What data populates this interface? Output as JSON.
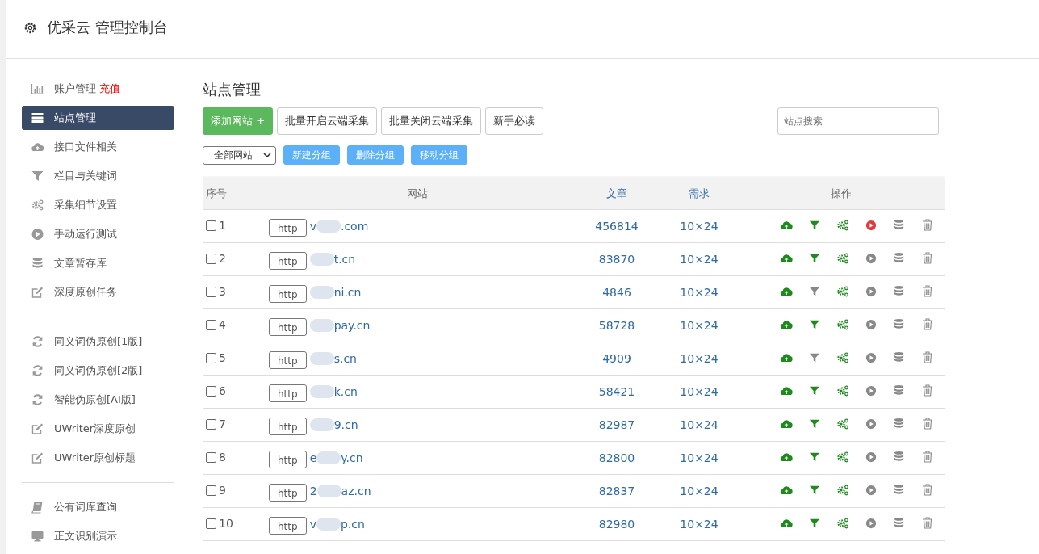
{
  "header": {
    "title": "优采云 管理控制台"
  },
  "sidebar": {
    "groups": [
      [
        {
          "kind": "chart",
          "label": "账户管理",
          "badge": "充值",
          "selected": false
        },
        {
          "kind": "list",
          "label": "站点管理",
          "selected": true
        },
        {
          "kind": "cloud",
          "label": "接口文件相关",
          "selected": false
        },
        {
          "kind": "filter",
          "label": "栏目与关键词",
          "selected": false
        },
        {
          "kind": "gears",
          "label": "采集细节设置",
          "selected": false
        },
        {
          "kind": "play",
          "label": "手动运行测试",
          "selected": false
        },
        {
          "kind": "database",
          "label": "文章暂存库",
          "selected": false
        },
        {
          "kind": "edit",
          "label": "深度原创任务",
          "selected": false
        }
      ],
      [
        {
          "kind": "refresh",
          "label": "同义词伪原创[1版]",
          "selected": false
        },
        {
          "kind": "refresh",
          "label": "同义词伪原创[2版]",
          "selected": false
        },
        {
          "kind": "refresh",
          "label": "智能伪原创[AI版]",
          "selected": false
        },
        {
          "kind": "edit",
          "label": "UWriter深度原创",
          "selected": false
        },
        {
          "kind": "edit",
          "label": "UWriter原创标题",
          "selected": false
        }
      ],
      [
        {
          "kind": "book",
          "label": "公有词库查询",
          "selected": false
        },
        {
          "kind": "monitor",
          "label": "正文识别演示",
          "selected": false
        }
      ]
    ]
  },
  "main": {
    "title": "站点管理",
    "buttons": [
      {
        "kind": "primary",
        "label": "添加网站 +"
      },
      {
        "kind": "default",
        "label": "批量开启云端采集"
      },
      {
        "kind": "default",
        "label": "批量关闭云端采集"
      },
      {
        "kind": "default",
        "label": "新手必读"
      }
    ],
    "search": {
      "placeholder": "站点搜索"
    },
    "group_select": {
      "value": "全部网站"
    },
    "group_buttons": [
      "新建分组",
      "删除分组",
      "移动分组"
    ],
    "table": {
      "columns": [
        "序号",
        "网站",
        "文章",
        "需求",
        "操作"
      ],
      "rows": [
        {
          "checked": false,
          "index": "1",
          "protocol": "http",
          "domain_start": "v",
          "domain_end": ".com",
          "articles": "456814",
          "demand": "10×24",
          "filter_on": true,
          "running": true
        },
        {
          "checked": false,
          "index": "2",
          "protocol": "http",
          "domain_start": "",
          "domain_end": "t.cn",
          "articles": "83870",
          "demand": "10×24",
          "filter_on": true,
          "running": false
        },
        {
          "checked": false,
          "index": "3",
          "protocol": "http",
          "domain_start": "",
          "domain_end": "ni.cn",
          "articles": "4846",
          "demand": "10×24",
          "filter_on": false,
          "running": false
        },
        {
          "checked": false,
          "index": "4",
          "protocol": "http",
          "domain_start": "",
          "domain_end": "pay.cn",
          "articles": "58728",
          "demand": "10×24",
          "filter_on": true,
          "running": false
        },
        {
          "checked": false,
          "index": "5",
          "protocol": "http",
          "domain_start": "",
          "domain_end": "s.cn",
          "articles": "4909",
          "demand": "10×24",
          "filter_on": false,
          "running": false
        },
        {
          "checked": false,
          "index": "6",
          "protocol": "http",
          "domain_start": "",
          "domain_end": "k.cn",
          "articles": "58421",
          "demand": "10×24",
          "filter_on": true,
          "running": false
        },
        {
          "checked": false,
          "index": "7",
          "protocol": "http",
          "domain_start": "",
          "domain_end": "9.cn",
          "articles": "82987",
          "demand": "10×24",
          "filter_on": true,
          "running": false
        },
        {
          "checked": false,
          "index": "8",
          "protocol": "http",
          "domain_start": "e",
          "domain_end": "y.cn",
          "articles": "82800",
          "demand": "10×24",
          "filter_on": true,
          "running": false
        },
        {
          "checked": false,
          "index": "9",
          "protocol": "http",
          "domain_start": "2",
          "domain_end": "az.cn",
          "articles": "82837",
          "demand": "10×24",
          "filter_on": true,
          "running": false
        },
        {
          "checked": false,
          "index": "10",
          "protocol": "http",
          "domain_start": "v",
          "domain_end": "p.cn",
          "articles": "82980",
          "demand": "10×24",
          "filter_on": true,
          "running": false
        }
      ]
    }
  }
}
